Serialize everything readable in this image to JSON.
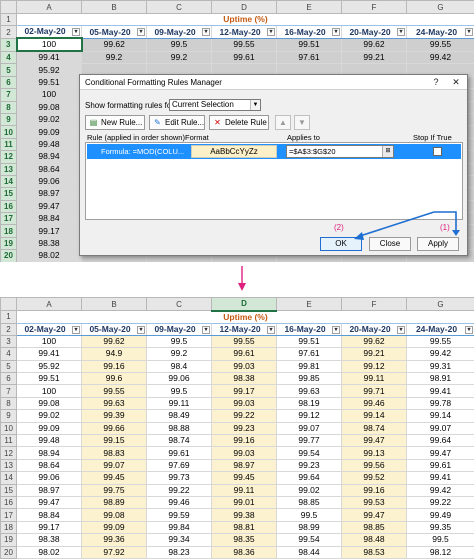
{
  "columns": [
    "A",
    "B",
    "C",
    "D",
    "E",
    "F",
    "G"
  ],
  "title": "Uptime (%)",
  "headers": [
    "02-May-20",
    "05-May-20",
    "09-May-20",
    "12-May-20",
    "16-May-20",
    "20-May-20",
    "24-May-20"
  ],
  "rows": [
    [
      "100",
      "99.62",
      "99.5",
      "99.55",
      "99.51",
      "99.62",
      "99.55"
    ],
    [
      "99.41",
      "94.9",
      "99.2",
      "99.61",
      "97.61",
      "99.21",
      "99.42"
    ],
    [
      "95.92",
      "99.16",
      "98.4",
      "99.03",
      "99.81",
      "99.12",
      "99.31"
    ],
    [
      "99.51",
      "99.6",
      "99.06",
      "98.38",
      "99.85",
      "99.11",
      "98.91"
    ],
    [
      "100",
      "99.55",
      "99.5",
      "99.17",
      "99.63",
      "99.71",
      "99.41"
    ],
    [
      "99.08",
      "99.63",
      "99.11",
      "99.03",
      "98.19",
      "99.46",
      "99.78"
    ],
    [
      "99.02",
      "99.39",
      "98.49",
      "99.22",
      "99.12",
      "99.14",
      "99.14"
    ],
    [
      "99.09",
      "99.66",
      "98.88",
      "99.23",
      "99.07",
      "98.74",
      "99.07"
    ],
    [
      "99.48",
      "99.15",
      "98.74",
      "99.16",
      "99.77",
      "99.47",
      "99.64"
    ],
    [
      "98.94",
      "98.83",
      "99.61",
      "99.03",
      "99.54",
      "99.13",
      "99.47"
    ],
    [
      "98.64",
      "99.07",
      "97.69",
      "98.97",
      "99.23",
      "99.56",
      "99.61"
    ],
    [
      "99.06",
      "99.45",
      "99.73",
      "99.45",
      "99.64",
      "99.52",
      "99.41"
    ],
    [
      "98.97",
      "99.75",
      "99.22",
      "99.11",
      "99.02",
      "99.16",
      "99.42"
    ],
    [
      "99.47",
      "98.89",
      "99.46",
      "99.01",
      "98.85",
      "99.53",
      "99.22"
    ],
    [
      "98.84",
      "99.08",
      "99.59",
      "99.38",
      "99.5",
      "99.47",
      "99.49"
    ],
    [
      "99.17",
      "99.09",
      "99.84",
      "98.81",
      "98.99",
      "98.85",
      "99.35"
    ],
    [
      "98.38",
      "99.36",
      "99.34",
      "98.35",
      "99.54",
      "98.48",
      "99.5"
    ],
    [
      "98.02",
      "97.92",
      "98.23",
      "98.36",
      "98.44",
      "98.53",
      "98.12"
    ]
  ],
  "top_rows_visible": [
    [
      "100",
      "99.62",
      "99.5",
      "99.55",
      "99.51",
      "99.62",
      "99.55"
    ],
    [
      "99.41",
      "99.2",
      "99.2",
      "99.61",
      "97.61",
      "99.21",
      "99.42"
    ],
    [
      "95.92",
      "",
      "",
      "",
      "",
      "",
      ""
    ],
    [
      "99.51",
      "",
      "",
      "",
      "",
      "",
      ""
    ],
    [
      "100",
      "",
      "",
      "",
      "",
      "",
      ""
    ],
    [
      "99.08",
      "",
      "",
      "",
      "",
      "",
      ""
    ],
    [
      "99.02",
      "",
      "",
      "",
      "",
      "",
      ""
    ],
    [
      "99.09",
      "",
      "",
      "",
      "",
      "",
      ""
    ],
    [
      "99.48",
      "",
      "",
      "",
      "",
      "",
      ""
    ],
    [
      "98.94",
      "",
      "",
      "",
      "",
      "",
      ""
    ],
    [
      "98.64",
      "",
      "",
      "",
      "",
      "",
      ""
    ],
    [
      "99.06",
      "",
      "",
      "",
      "",
      "",
      ""
    ],
    [
      "98.97",
      "",
      "",
      "",
      "",
      "",
      ""
    ],
    [
      "99.47",
      "",
      "",
      "",
      "",
      "",
      ""
    ],
    [
      "98.84",
      "",
      "",
      "",
      "",
      "",
      ""
    ],
    [
      "99.17",
      "",
      "",
      "",
      "",
      "",
      ""
    ],
    [
      "98.38",
      "",
      "",
      "",
      "",
      "",
      ""
    ],
    [
      "98.02",
      "",
      "",
      "",
      "",
      "",
      ""
    ]
  ],
  "dialog": {
    "title": "Conditional Formatting Rules Manager",
    "help": "?",
    "close": "✕",
    "show_label": "Show formatting rules for:",
    "show_value": "Current Selection",
    "new_rule": "New Rule...",
    "edit_rule": "Edit Rule...",
    "delete_rule": "Delete Rule",
    "col_rule": "Rule (applied in order shown)",
    "col_format": "Format",
    "col_applies": "Applies to",
    "col_stop": "Stop If True",
    "rule_name": "Formula: =MOD(COLU...",
    "rule_preview": "AaBbCcYyZz",
    "rule_applies": "=$A$3:$G$20",
    "ok": "OK",
    "close_btn": "Close",
    "apply": "Apply"
  },
  "annotations": {
    "step1": "(1)",
    "step2": "(2)"
  },
  "colors": {
    "highlight": "#fdf2d0",
    "title": "#c55a11",
    "header_text": "#1f3864",
    "selected_rule": "#1e90ff",
    "annotation": "#e0207f",
    "arrow": "#1e6fd1"
  }
}
